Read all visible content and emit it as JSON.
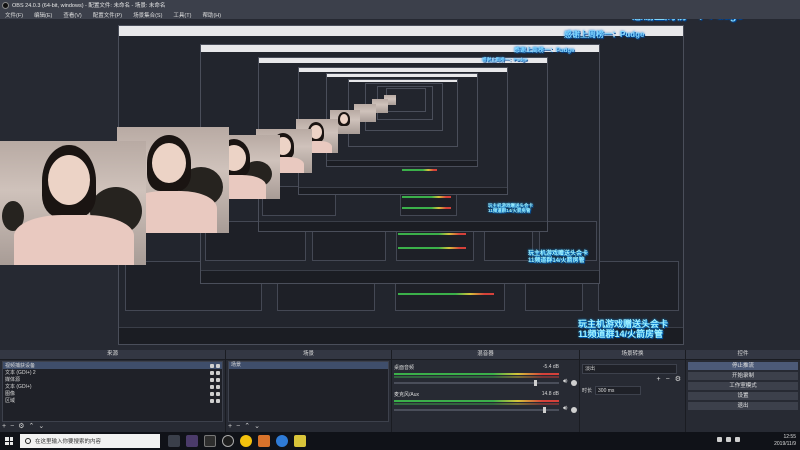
{
  "window": {
    "title": "OBS 24.0.3 (64-bit, windows) - 配置文件: 未命名 - 场景: 未命名"
  },
  "menu": [
    "文件(F)",
    "编辑(E)",
    "查看(V)",
    "配置文件(P)",
    "场景集合(S)",
    "工具(T)",
    "帮助(H)"
  ],
  "overlay": {
    "thanks": "感谢上周榜一：Pudge",
    "promo_line1": "玩主机游戏赠送头会卡",
    "promo_line2": "11频道群14/火箭房管"
  },
  "docks": {
    "sources": {
      "title": "来源",
      "items": [
        "视频捕获设备",
        "文本 (GDI+) 2",
        "媒体源",
        "文本 (GDI+)",
        "图像",
        "区域"
      ]
    },
    "scenes": {
      "title": "场景",
      "items": [
        "场景"
      ]
    },
    "mixer": {
      "title": "混音器",
      "channels": [
        {
          "name": "桌面音频",
          "db": "-5.4 dB",
          "level": 0.85
        },
        {
          "name": "麦克风/Aux",
          "db": "14.8 dB",
          "level": 0.9
        }
      ]
    },
    "transitions": {
      "title": "场景转换",
      "selected": "淡出",
      "duration_label": "时长",
      "duration_value": "300 ms"
    },
    "controls": {
      "title": "控件",
      "buttons": [
        "停止推流",
        "开始录制",
        "工作室模式",
        "设置",
        "退出"
      ]
    }
  },
  "taskbar": {
    "search_placeholder": "在这里输入你要搜索的内容",
    "time": "12:55",
    "date": "2019/11/9"
  },
  "colors": {
    "accent": "#4c5a78",
    "overlay_text": "#7fd6ff",
    "meter_green": "#3bb04a"
  }
}
